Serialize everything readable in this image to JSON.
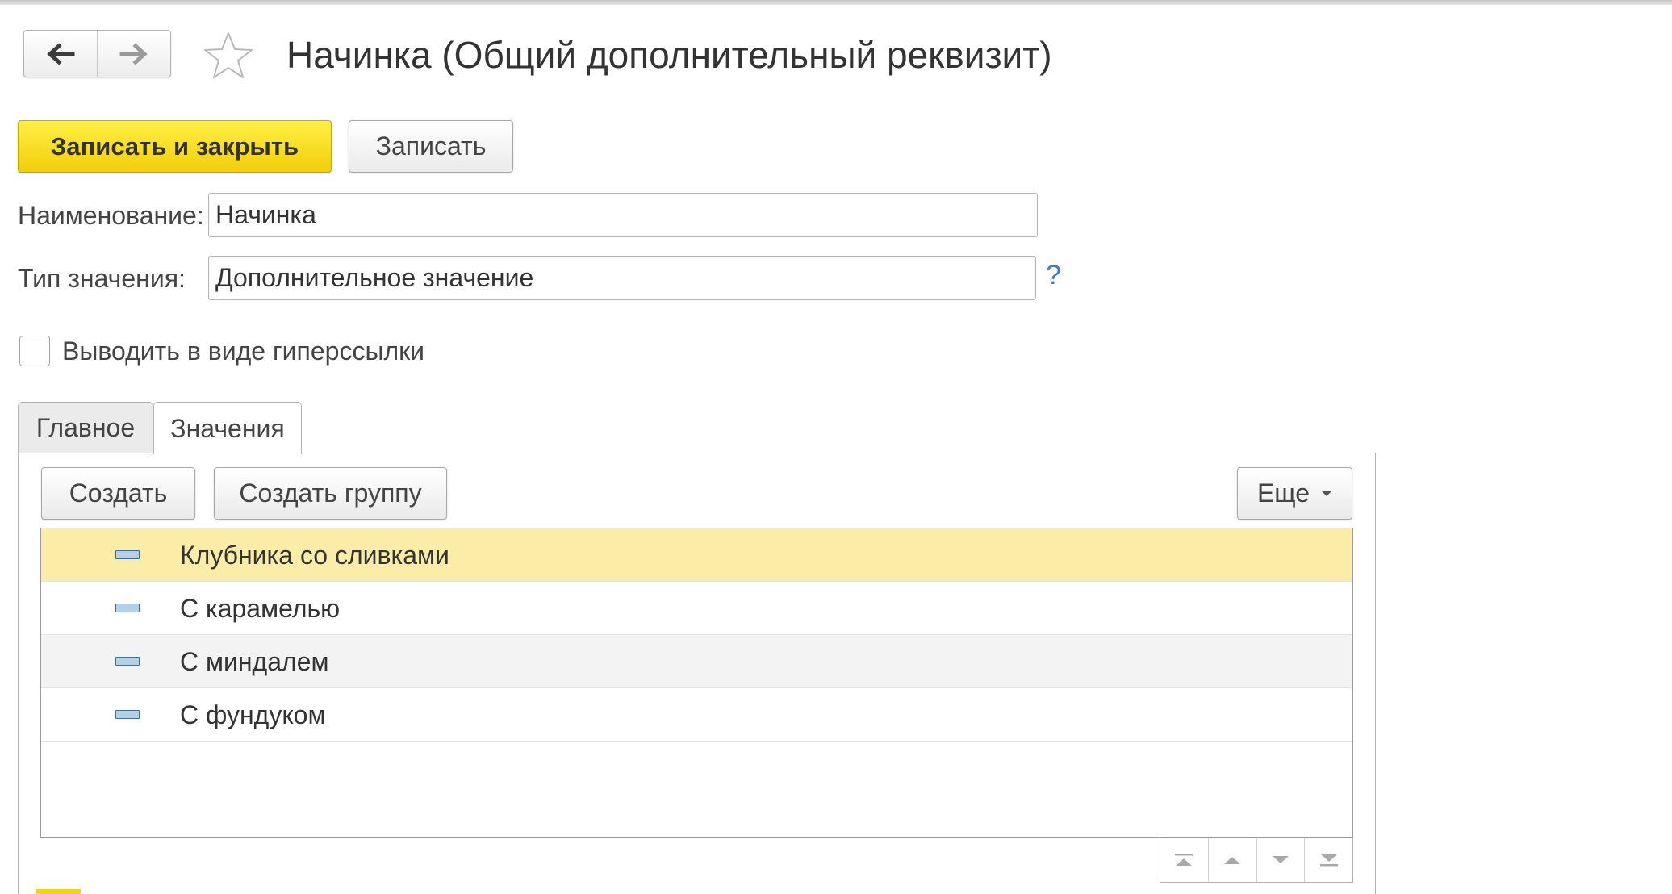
{
  "window": {
    "title": "Начинка (Общий дополнительный реквизит)"
  },
  "nav": {
    "back_icon": "arrow-left-icon",
    "forward_icon": "arrow-right-icon",
    "favorite_icon": "star-icon"
  },
  "toolbar": {
    "save_close_label": "Записать и закрыть",
    "save_label": "Записать"
  },
  "form": {
    "name_label": "Наименование:",
    "name_value": "Начинка",
    "type_label": "Тип значения:",
    "type_value": "Дополнительное значение",
    "help_label": "?",
    "hyperlink_checkbox_label": "Выводить в виде гиперссылки",
    "hyperlink_checked": false
  },
  "tabs": [
    {
      "label": "Главное",
      "active": false
    },
    {
      "label": "Значения",
      "active": true
    }
  ],
  "values_panel": {
    "create_label": "Создать",
    "create_group_label": "Создать группу",
    "more_label": "Еще",
    "items": [
      {
        "label": "Клубника со сливками",
        "selected": true
      },
      {
        "label": "С карамелью",
        "selected": false
      },
      {
        "label": "С миндалем",
        "selected": false
      },
      {
        "label": "С фундуком",
        "selected": false
      }
    ],
    "move_buttons": [
      "move-to-top-icon",
      "move-up-icon",
      "move-down-icon",
      "move-to-bottom-icon"
    ]
  },
  "colors": {
    "accent": "#f2cd0a",
    "selected_row": "#fbeda8",
    "help_link": "#3b78c4"
  }
}
